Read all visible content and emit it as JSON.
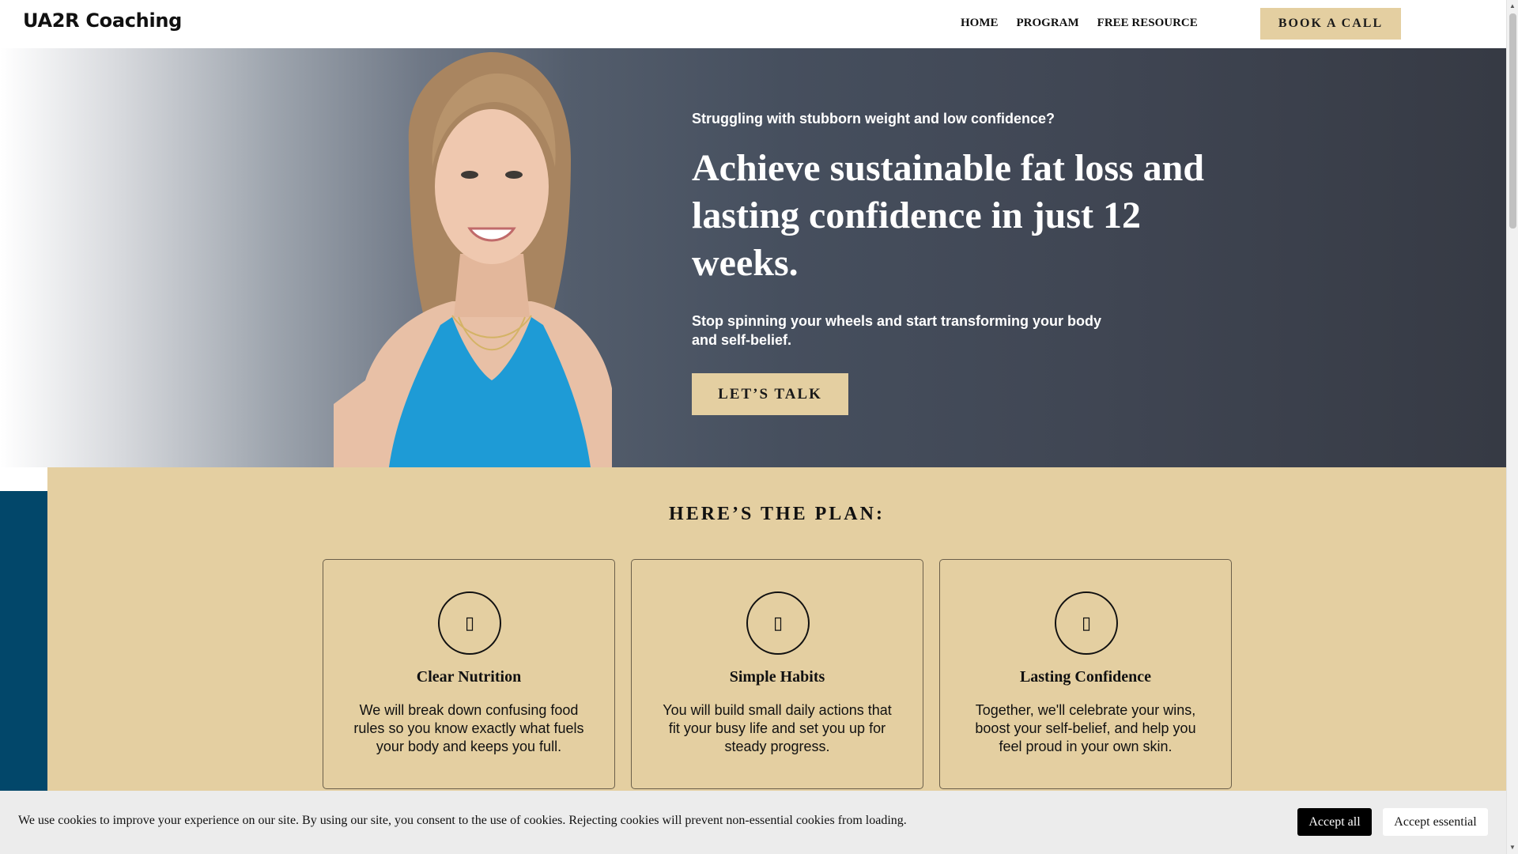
{
  "header": {
    "logo": "UA2R Coaching",
    "nav": [
      "HOME",
      "PROGRAM",
      "FREE RESOURCE"
    ],
    "cta_label": "BOOK A CALL"
  },
  "hero": {
    "kicker": "Struggling with stubborn weight and low confidence?",
    "title": "Achieve sustainable fat loss and lasting confidence in just 12 weeks.",
    "subtitle": "Stop spinning your wheels and start transforming your body and self-belief.",
    "cta_label": "LET’S TALK"
  },
  "plan": {
    "title": "HERE’S THE PLAN:",
    "cards": [
      {
        "title": "Clear Nutrition",
        "text": "We will break down confusing food rules so you know exactly what fuels your body and keeps you full.",
        "icon": "nutrition-icon"
      },
      {
        "title": "Simple Habits",
        "text": "You will build small daily actions that fit your busy life and set you up for steady progress.",
        "icon": "habits-icon"
      },
      {
        "title": "Lasting Confidence",
        "text": "Together, we'll celebrate your wins, boost your self-belief, and help you feel proud in your own skin.",
        "icon": "confidence-icon"
      }
    ]
  },
  "cookie": {
    "text": "We use cookies to improve your experience on our site. By using our site, you consent to the use of cookies. Rejecting cookies will prevent non-essential cookies from loading.",
    "accept_all": "Accept all",
    "accept_essential": "Accept essential"
  },
  "colors": {
    "accent": "#e4cfa1",
    "navy": "#02476a",
    "hero_dark": "#3f4552",
    "dress_blue": "#1e9bd6"
  },
  "icons": {
    "card_icon_glyph": "▯",
    "scroll_up": "▲",
    "scroll_down": "▼"
  }
}
